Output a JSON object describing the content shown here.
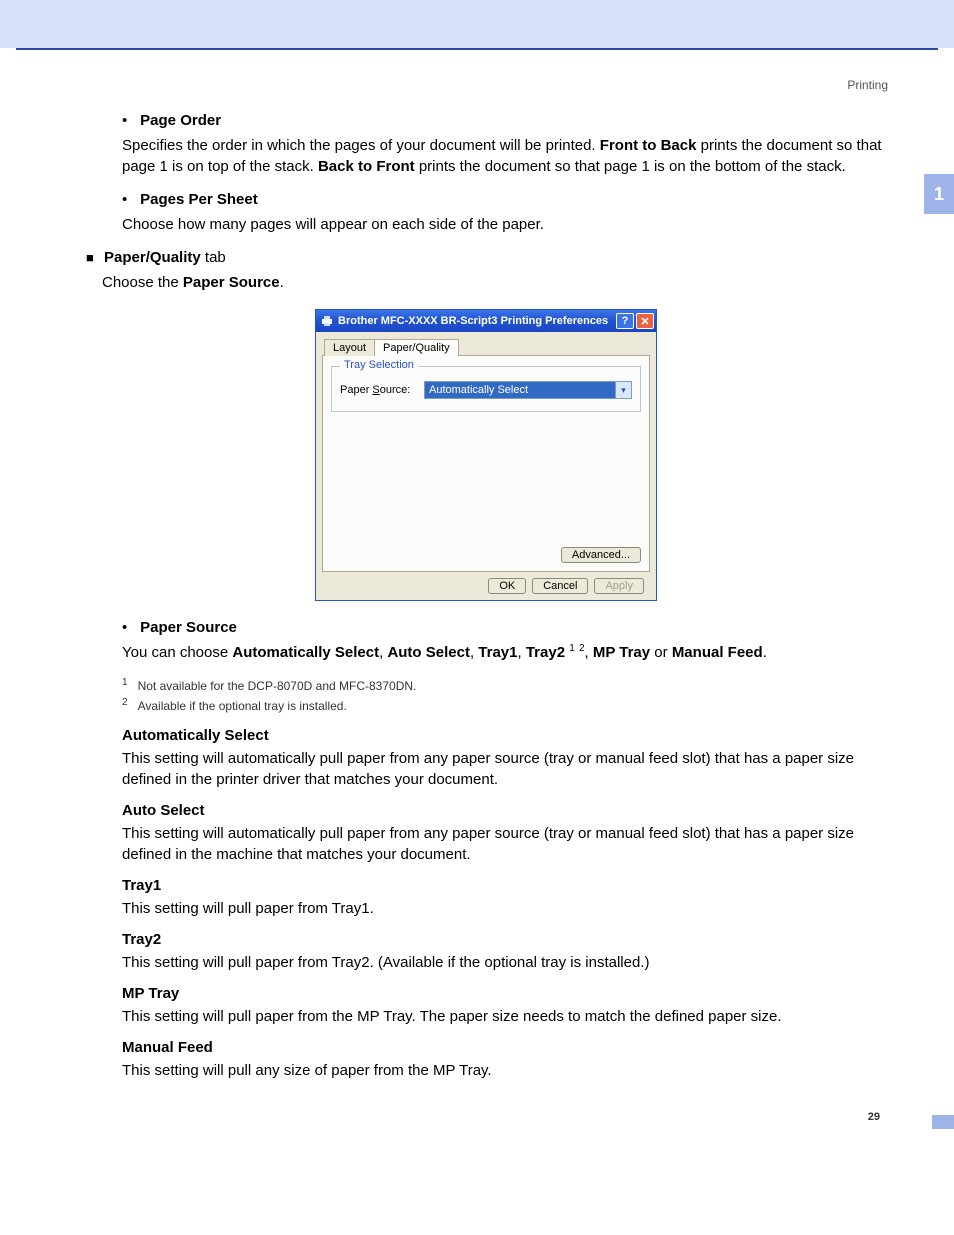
{
  "header": {
    "section": "Printing"
  },
  "chapter_tab": "1",
  "page_number": "29",
  "list": {
    "page_order": {
      "title": "Page Order",
      "body_1": "Specifies the order in which the pages of your document will be printed. ",
      "b1": "Front to Back",
      "body_2": " prints the document so that page 1 is on top of the stack. ",
      "b2": "Back to Front",
      "body_3": " prints the document so that page 1 is on the bottom of the stack."
    },
    "pages_per_sheet": {
      "title": "Pages Per Sheet",
      "body": "Choose how many pages will appear on each side of the paper."
    }
  },
  "block": {
    "title_strong": "Paper/Quality",
    "title_rest": " tab",
    "sub_1": "Choose the ",
    "sub_b": "Paper Source",
    "sub_2": "."
  },
  "dialog": {
    "title": "Brother MFC-XXXX BR-Script3 Printing Preferences",
    "tabs": {
      "layout": "Layout",
      "paper_quality": "Paper/Quality"
    },
    "group_legend": "Tray Selection",
    "paper_source_label_pre": "Paper ",
    "paper_source_label_u": "S",
    "paper_source_label_post": "ource:",
    "paper_source_value": "Automatically Select",
    "advanced_label": "Advanced...",
    "ok": "OK",
    "cancel": "Cancel",
    "apply": "Apply"
  },
  "paper_source": {
    "title": "Paper Source",
    "p_1": "You can choose ",
    "opt1": "Automatically Select",
    "sep": ", ",
    "opt2": "Auto Select",
    "opt3": "Tray1",
    "opt4": "Tray2",
    "sup12_1": "1",
    "sup12_2": "2",
    "opt5": "MP Tray",
    "or": " or ",
    "opt6": "Manual Feed",
    "p_end": "."
  },
  "footnotes": {
    "f1_num": "1",
    "f1": "Not available for the DCP-8070D and MFC-8370DN.",
    "f2_num": "2",
    "f2": "Available if the optional tray is installed."
  },
  "subs": {
    "auto_select": {
      "h": "Automatically Select",
      "b": "This setting will automatically pull paper from any paper source (tray or manual feed slot) that has a paper size defined in the printer driver that matches your document."
    },
    "auto": {
      "h": "Auto Select",
      "b": "This setting will automatically pull paper from any paper source (tray or manual feed slot) that has a paper size defined in the machine that matches your document."
    },
    "tray1": {
      "h": "Tray1",
      "b": "This setting will pull paper from Tray1."
    },
    "tray2": {
      "h": "Tray2",
      "b": "This setting will pull paper from Tray2. (Available if the optional tray is installed.)"
    },
    "mptray": {
      "h": "MP Tray",
      "b": "This setting will pull paper from the MP Tray. The paper size needs to match the defined paper size."
    },
    "manual": {
      "h": "Manual Feed",
      "b": "This setting will pull any size of paper from the MP Tray."
    }
  }
}
